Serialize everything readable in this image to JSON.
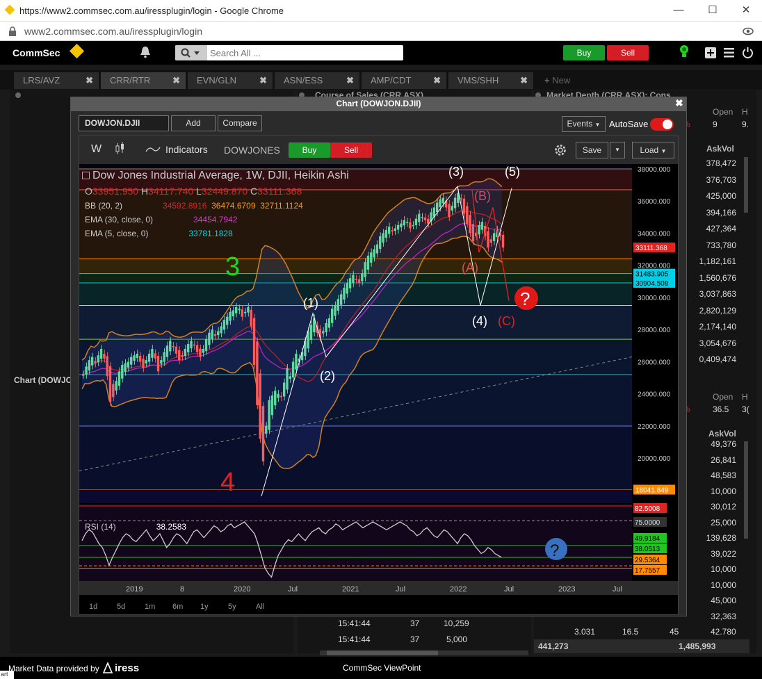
{
  "browser": {
    "title": "https://www2.commsec.com.au/iressplugin/login - Google Chrome",
    "url": "www2.commsec.com.au/iressplugin/login",
    "minimize": "—",
    "maximize": "☐",
    "close": "✕"
  },
  "topbar": {
    "logo": "CommSec",
    "search_placeholder": "Search All ...",
    "buy": "Buy",
    "sell": "Sell"
  },
  "tabs": [
    {
      "label": "LRS/AVZ"
    },
    {
      "label": "CRR/RTR"
    },
    {
      "label": "EVN/GLN"
    },
    {
      "label": "ASN/ESS"
    },
    {
      "label": "AMP/CDT"
    },
    {
      "label": "VMS/SHH"
    },
    {
      "label": "New"
    }
  ],
  "panels": {
    "course_of_sales": "Course of Sales (CRR.ASX)",
    "market_depth": "Market Depth (CRR.ASX): Cons...",
    "left_chart_label": "Chart (DOWJO"
  },
  "modal": {
    "title": "Chart (DOWJON.DJII)",
    "symbol": "DOWJON.DJII",
    "add": "Add",
    "compare": "Compare",
    "events": "Events",
    "autosave": "AutoSave"
  },
  "toolbar": {
    "interval": "W",
    "indicators": "Indicators",
    "symbol_name": "DOWJONES",
    "buy": "Buy",
    "sell": "Sell",
    "save": "Save",
    "load": "Load"
  },
  "chart_legend": {
    "title": "Dow Jones Industrial Average, 1W, DJII, Heikin Ashi",
    "ohlc": [
      {
        "k": "O",
        "v": "33951.950"
      },
      {
        "k": "H",
        "v": "34117.740"
      },
      {
        "k": "L",
        "v": "32449.870"
      },
      {
        "k": "C",
        "v": "33111.368"
      }
    ],
    "bb_label": "BB (20, 2)",
    "bb_values": [
      "34592.8916",
      "36474.6709",
      "32711.1124"
    ],
    "ema30_label": "EMA (30, close, 0)",
    "ema30_value": "34454.7942",
    "ema5_label": "EMA (5, close, 0)",
    "ema5_value": "33781.1828",
    "rsi_label": "RSI (14)",
    "rsi_value": "38.2583"
  },
  "price_axis": {
    "ticks": [
      "38000.000",
      "36000.000",
      "34000.000",
      "32000.000",
      "30000.000",
      "28000.000",
      "26000.000",
      "24000.000",
      "22000.000",
      "20000.000"
    ],
    "badges": [
      {
        "v": "33111.368",
        "c": "#e02424",
        "fg": "#fff",
        "p": 33111
      },
      {
        "v": "31483.905",
        "c": "#00cfe8",
        "fg": "#000",
        "p": 31484
      },
      {
        "v": "30904.508",
        "c": "#00cfe8",
        "fg": "#000",
        "p": 30905
      },
      {
        "v": "18041.849",
        "c": "#ff8c00",
        "fg": "#fff",
        "p": 18042
      }
    ]
  },
  "rsi_axis": {
    "badges": [
      {
        "v": "82.5008",
        "c": "#e02424",
        "fg": "#fff"
      },
      {
        "v": "75.0000",
        "c": "#333",
        "fg": "#ddd"
      },
      {
        "v": "49.9184",
        "c": "#22c422",
        "fg": "#000"
      },
      {
        "v": "38.0513",
        "c": "#22c422",
        "fg": "#000"
      },
      {
        "v": "29.5364",
        "c": "#ff8c00",
        "fg": "#000"
      },
      {
        "v": "17.7557",
        "c": "#ff8c00",
        "fg": "#000"
      }
    ]
  },
  "time_axis": [
    "2019",
    "8",
    "2020",
    "Jul",
    "2021",
    "Jul",
    "2022",
    "Jul",
    "2023",
    "Jul"
  ],
  "ranges": [
    "1d",
    "5d",
    "1m",
    "6m",
    "1y",
    "5y",
    "All"
  ],
  "annotations": {
    "wave3": "3",
    "wave4": "4",
    "w1": "(1)",
    "w2": "(2)",
    "w3": "(3)",
    "w4": "(4)",
    "w5": "(5)",
    "wA": "(A)",
    "wB": "(B)",
    "wC": "(C)",
    "question": "?"
  },
  "depth": {
    "header_open": "Open",
    "header_h": "H",
    "row0": [
      "%",
      "9",
      "9."
    ],
    "askvol_label": "AskVol",
    "askvol": [
      "378,472",
      "376,703",
      "425,000",
      "394,166",
      "427,364",
      "733,780",
      "1,182,161",
      "1,560,676",
      "3,037,863",
      "2,820,129",
      "2,174,140",
      "3,054,676",
      "0,409,474"
    ],
    "header2_open": "Open",
    "header2_h": "H",
    "row2": [
      "%",
      "36.5",
      "3("
    ],
    "askvol2_label": "AskVol",
    "askvol2": [
      "49,376",
      "26,841",
      "48,583",
      "10,000",
      "30,012",
      "25,000",
      "139,628",
      "39,022",
      "10,000",
      "10,000",
      "45,000",
      "32,363"
    ],
    "footer_row": [
      "3.031",
      "16.5",
      "45",
      "42.780"
    ],
    "totals": [
      "441,273",
      "1,485,993"
    ]
  },
  "cos": {
    "rows": [
      {
        "t": "15:41:44",
        "p": "37",
        "v": "10,259"
      },
      {
        "t": "15:41:44",
        "p": "37",
        "v": "5,000"
      }
    ]
  },
  "bottom": {
    "provided": "Market Data provided by",
    "brand": "iress",
    "center": "CommSec ViewPoint",
    "corner": "art"
  },
  "chart_data": {
    "type": "candlestick",
    "title": "Dow Jones Industrial Average, 1W, DJII, Heikin Ashi",
    "ylim": [
      17200,
      38300
    ],
    "x_ticks": [
      "2019",
      "8",
      "2020",
      "Jul",
      "2021",
      "Jul",
      "2022",
      "Jul",
      "2023",
      "Jul"
    ],
    "close_series": [
      25200,
      25700,
      26100,
      26300,
      25900,
      26400,
      26800,
      26200,
      25100,
      23500,
      23800,
      24800,
      25400,
      25800,
      25900,
      26000,
      26300,
      26400,
      26500,
      26000,
      25600,
      26100,
      26500,
      26800,
      26200,
      25400,
      26100,
      26600,
      27000,
      27300,
      26900,
      26500,
      26100,
      26300,
      26800,
      27100,
      27300,
      27000,
      26600,
      26300,
      26800,
      27400,
      27800,
      28000,
      27600,
      27900,
      28200,
      28600,
      28800,
      29100,
      29200,
      29400,
      29300,
      28800,
      29100,
      29400,
      28200,
      25800,
      23300,
      21200,
      19800,
      22000,
      23600,
      23900,
      24200,
      24000,
      23800,
      24700,
      25600,
      25100,
      26000,
      26500,
      26200,
      26600,
      27300,
      27900,
      28300,
      28700,
      27800,
      27500,
      27900,
      28400,
      28700,
      29300,
      29500,
      29900,
      30200,
      30600,
      30900,
      31200,
      31400,
      31100,
      30900,
      31500,
      32200,
      32600,
      32800,
      33000,
      33300,
      33800,
      34000,
      34200,
      34400,
      34100,
      34300,
      34500,
      34600,
      34800,
      34700,
      34300,
      34500,
      34900,
      35200,
      35000,
      34800,
      34600,
      35300,
      35600,
      35900,
      36100,
      36200,
      35600,
      35000,
      35700,
      36200,
      36500,
      36100,
      35200,
      34600,
      34000,
      33500,
      33800,
      34500,
      34700,
      33800,
      33100,
      33400,
      34000,
      34200,
      33800,
      33100
    ],
    "indicators": {
      "bb": {
        "basis": 34592.8916,
        "upper": 36474.6709,
        "lower": 32711.1124
      },
      "ema30": 34454.7942,
      "ema5": 33781.1828,
      "rsi14": 38.2583
    },
    "rsi_series": [
      55,
      62,
      66,
      64,
      58,
      52,
      48,
      40,
      30,
      38,
      45,
      52,
      58,
      62,
      60,
      56,
      54,
      58,
      62,
      66,
      60,
      55,
      58,
      62,
      55,
      48,
      52,
      58,
      62,
      60,
      56,
      52,
      58,
      64,
      66,
      62,
      58,
      62,
      66,
      70,
      68,
      64,
      66,
      70,
      72,
      68,
      70,
      72,
      74,
      70,
      66,
      62,
      52,
      40,
      28,
      22,
      18,
      30,
      40,
      46,
      52,
      56,
      54,
      58,
      62,
      58,
      55,
      60,
      64,
      66,
      68,
      64,
      62,
      66,
      68,
      72,
      70,
      66,
      68,
      70,
      72,
      74,
      71,
      68,
      70,
      72,
      74,
      72,
      70,
      68,
      66,
      68,
      70,
      72,
      74,
      72,
      70,
      66,
      64,
      60,
      62,
      66,
      68,
      64,
      60,
      58,
      62,
      66,
      64,
      60,
      56,
      52,
      58,
      62,
      60,
      56,
      50,
      46,
      42,
      44,
      48,
      46,
      42,
      40,
      38
    ],
    "fib_levels": [
      38000,
      36700,
      32400,
      31484,
      30904,
      29500,
      27400,
      25200,
      22000,
      18042
    ],
    "annotations": [
      {
        "label": "(1)",
        "price": 29000
      },
      {
        "label": "(2)",
        "price": 26300
      },
      {
        "label": "(3)",
        "price": 36800
      },
      {
        "label": "(4)",
        "price": 29500
      },
      {
        "label": "(5)",
        "price": 36800
      },
      {
        "label": "(A)",
        "price": 32700
      },
      {
        "label": "(B)",
        "price": 35500
      },
      {
        "label": "(C)",
        "price": 29800
      }
    ]
  }
}
